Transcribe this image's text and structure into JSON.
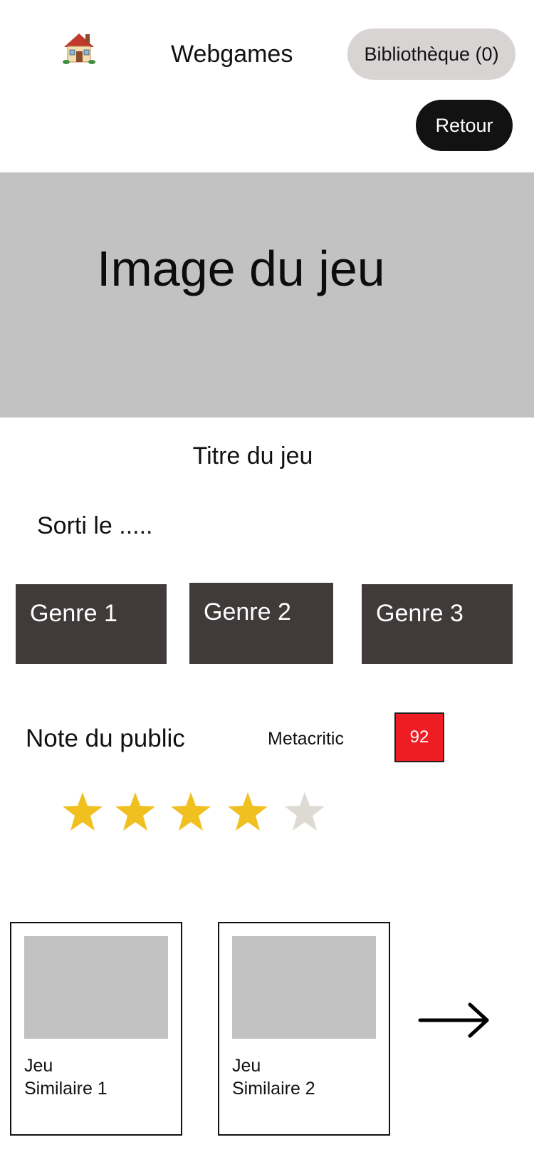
{
  "header": {
    "home_icon": "house-emoji",
    "title": "Webgames",
    "library_label": "Bibliothèque (0)",
    "back_label": "Retour"
  },
  "hero": {
    "placeholder": "Image du jeu"
  },
  "game": {
    "title": "Titre du jeu",
    "release": "Sorti le .....",
    "genres": [
      "Genre 1",
      "Genre 2",
      "Genre 3"
    ]
  },
  "ratings": {
    "public_label": "Note du public",
    "metacritic_label": "Metacritic",
    "metacritic_score": "92",
    "stars_filled": 4,
    "stars_total": 5
  },
  "similar": {
    "items": [
      {
        "label_line1": "Jeu",
        "label_line2": "Similaire 1"
      },
      {
        "label_line1": "Jeu",
        "label_line2": "Similaire 2"
      }
    ],
    "next_icon": "arrow-right-icon"
  },
  "colors": {
    "star_filled": "#f0c020",
    "star_empty": "#dcdad2",
    "metacritic_bg": "#ee1d23",
    "genre_bg": "#403a3a",
    "placeholder_bg": "#c2c2c2"
  }
}
